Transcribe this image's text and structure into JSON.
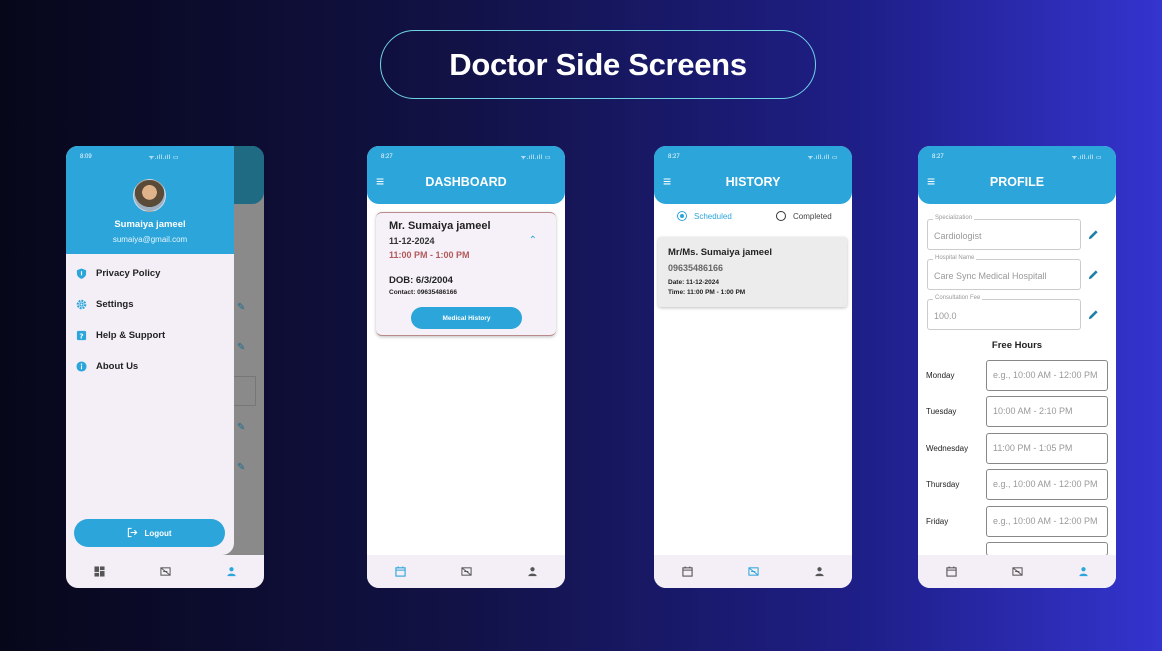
{
  "page": {
    "title": "Doctor Side Screens"
  },
  "colors": {
    "primary": "#2ba5da",
    "time": "#b25a5a"
  },
  "phone1": {
    "status_time": "8:09",
    "status_icons": "ᯤ.ıll.ıll ▭",
    "user_name": "Sumaiya jameel",
    "user_email": "sumaiya@gmail.com",
    "menu": [
      {
        "label": "Privacy Policy",
        "icon": "shield-icon"
      },
      {
        "label": "Settings",
        "icon": "gear-icon"
      },
      {
        "label": "Help & Support",
        "icon": "help-icon"
      },
      {
        "label": "About Us",
        "icon": "info-icon"
      }
    ],
    "logout_label": "Logout"
  },
  "phone2": {
    "status_time": "8:27",
    "status_icons": "ᯤ.ıll.ıll ▭",
    "title": "DASHBOARD",
    "appointment": {
      "name": "Mr. Sumaiya jameel",
      "date": "11-12-2024",
      "time": "11:00 PM - 1:00 PM",
      "dob": "DOB: 6/3/2004",
      "contact": "Contact: 09635486166",
      "button": "Medical History"
    }
  },
  "phone3": {
    "status_time": "8:27",
    "status_icons": "ᯤ.ıll.ıll ▭",
    "title": "HISTORY",
    "tabs": {
      "scheduled": "Scheduled",
      "completed": "Completed"
    },
    "record": {
      "name": "Mr/Ms. Sumaiya jameel",
      "phone": "09635486166",
      "date": "Date: 11-12-2024",
      "time": "Time: 11:00 PM - 1:00 PM"
    }
  },
  "phone4": {
    "status_time": "8:27",
    "status_icons": "ᯤ.ıll.ıll ▭",
    "title": "PROFILE",
    "fields": [
      {
        "label": "Specialization",
        "value": "Cardiologist"
      },
      {
        "label": "Hospital Name",
        "value": "Care Sync Medical Hospitall"
      },
      {
        "label": "Consultation Fee",
        "value": "100.0"
      }
    ],
    "free_hours_title": "Free Hours",
    "days": [
      {
        "day": "Monday",
        "value": "e.g., 10:00 AM - 12:00 PM"
      },
      {
        "day": "Tuesday",
        "value": "10:00 AM - 2:10 PM"
      },
      {
        "day": "Wednesday",
        "value": "11:00 PM - 1:05 PM"
      },
      {
        "day": "Thursday",
        "value": "e.g., 10:00 AM - 12:00 PM"
      },
      {
        "day": "Friday",
        "value": "e.g., 10:00 AM - 12:00 PM"
      }
    ]
  }
}
